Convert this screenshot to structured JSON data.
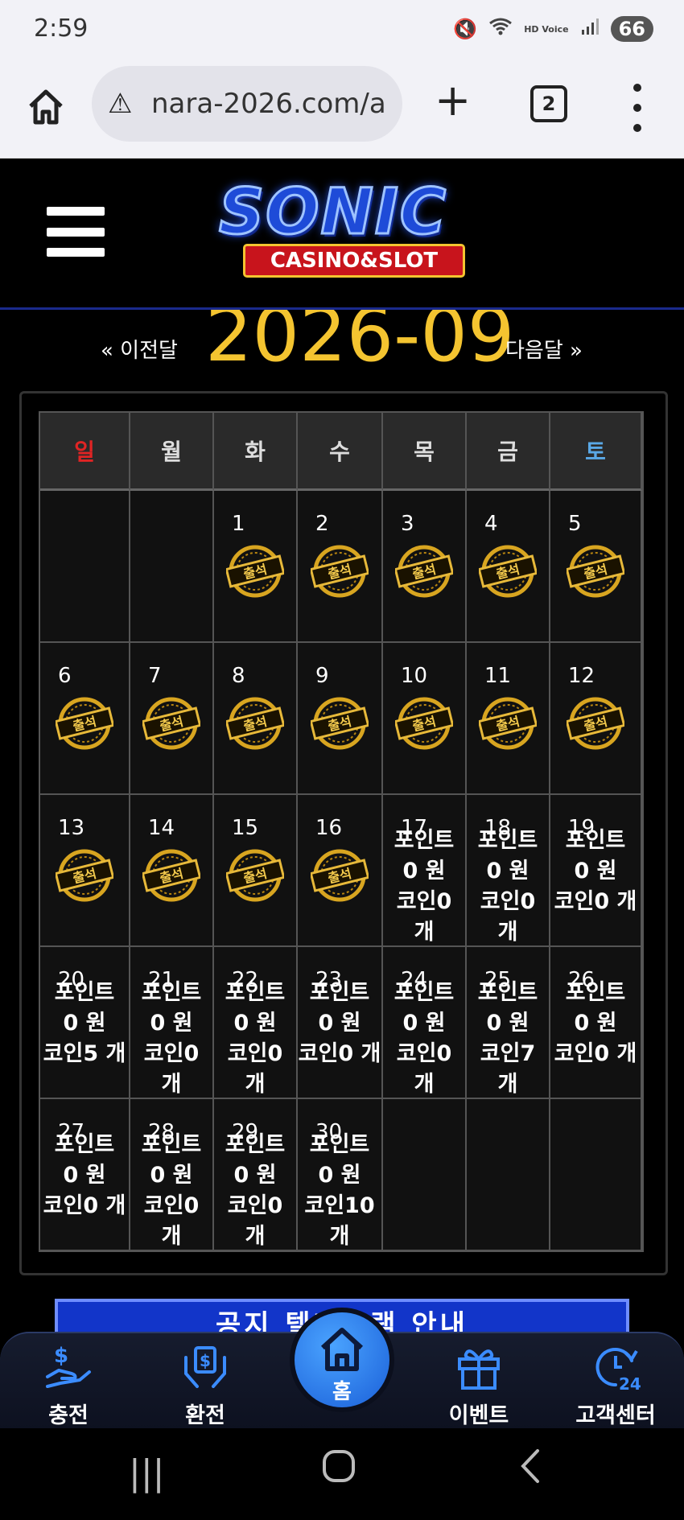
{
  "status_bar": {
    "time": "2:59",
    "battery": "66",
    "signal_text": "HD Voice"
  },
  "browser": {
    "url": "nara-2026.com/a",
    "tab_count": "2"
  },
  "site": {
    "logo_main": "SONIC",
    "logo_sub": "CASINO&SLOT"
  },
  "calendar": {
    "prev_label": "« 이전달",
    "current_month": "2026-09",
    "next_label": "다음달 »",
    "weekdays": [
      "일",
      "월",
      "화",
      "수",
      "목",
      "금",
      "토"
    ],
    "weekday_colors": {
      "sun": "#e02424",
      "sat": "#5aa8e6",
      "default": "#dddddd"
    },
    "stamp_text": "출석",
    "weeks": [
      [
        {
          "day": ""
        },
        {
          "day": ""
        },
        {
          "day": "1",
          "stamp": true
        },
        {
          "day": "2",
          "stamp": true
        },
        {
          "day": "3",
          "stamp": true
        },
        {
          "day": "4",
          "stamp": true
        },
        {
          "day": "5",
          "stamp": true
        }
      ],
      [
        {
          "day": "6",
          "stamp": true
        },
        {
          "day": "7",
          "stamp": true
        },
        {
          "day": "8",
          "stamp": true
        },
        {
          "day": "9",
          "stamp": true
        },
        {
          "day": "10",
          "stamp": true
        },
        {
          "day": "11",
          "stamp": true
        },
        {
          "day": "12",
          "stamp": true
        }
      ],
      [
        {
          "day": "13",
          "stamp": true
        },
        {
          "day": "14",
          "stamp": true
        },
        {
          "day": "15",
          "stamp": true
        },
        {
          "day": "16",
          "stamp": true
        },
        {
          "day": "17",
          "point": "포인트",
          "won": "0 원",
          "coin": "코인0 개"
        },
        {
          "day": "18",
          "point": "포인트",
          "won": "0 원",
          "coin": "코인0 개"
        },
        {
          "day": "19",
          "point": "포인트",
          "won": "0 원",
          "coin": "코인0 개"
        }
      ],
      [
        {
          "day": "20",
          "point": "포인트",
          "won": "0 원",
          "coin": "코인5 개"
        },
        {
          "day": "21",
          "point": "포인트",
          "won": "0 원",
          "coin": "코인0 개"
        },
        {
          "day": "22",
          "point": "포인트",
          "won": "0 원",
          "coin": "코인0 개"
        },
        {
          "day": "23",
          "point": "포인트",
          "won": "0 원",
          "coin": "코인0 개"
        },
        {
          "day": "24",
          "point": "포인트",
          "won": "0 원",
          "coin": "코인0 개"
        },
        {
          "day": "25",
          "point": "포인트",
          "won": "0 원",
          "coin": "코인7 개"
        },
        {
          "day": "26",
          "point": "포인트",
          "won": "0 원",
          "coin": "코인0 개"
        }
      ],
      [
        {
          "day": "27",
          "point": "포인트",
          "won": "0 원",
          "coin": "코인0 개"
        },
        {
          "day": "28",
          "point": "포인트",
          "won": "0 원",
          "coin": "코인0 개"
        },
        {
          "day": "29",
          "point": "포인트",
          "won": "0 원",
          "coin": "코인0 개"
        },
        {
          "day": "30",
          "point": "포인트",
          "won": "0 원",
          "coin": "코인10 개"
        },
        {
          "day": ""
        },
        {
          "day": ""
        },
        {
          "day": ""
        }
      ]
    ]
  },
  "banner": {
    "text": "공지 텔레그램 안내"
  },
  "bottom_nav": {
    "items": [
      {
        "label": "충전",
        "icon": "hand-dollar-icon"
      },
      {
        "label": "환전",
        "icon": "hands-money-icon"
      },
      {
        "label": "홈",
        "icon": "home-icon"
      },
      {
        "label": "이벤트",
        "icon": "gift-icon"
      },
      {
        "label": "고객센터",
        "icon": "support-24-icon"
      }
    ]
  }
}
